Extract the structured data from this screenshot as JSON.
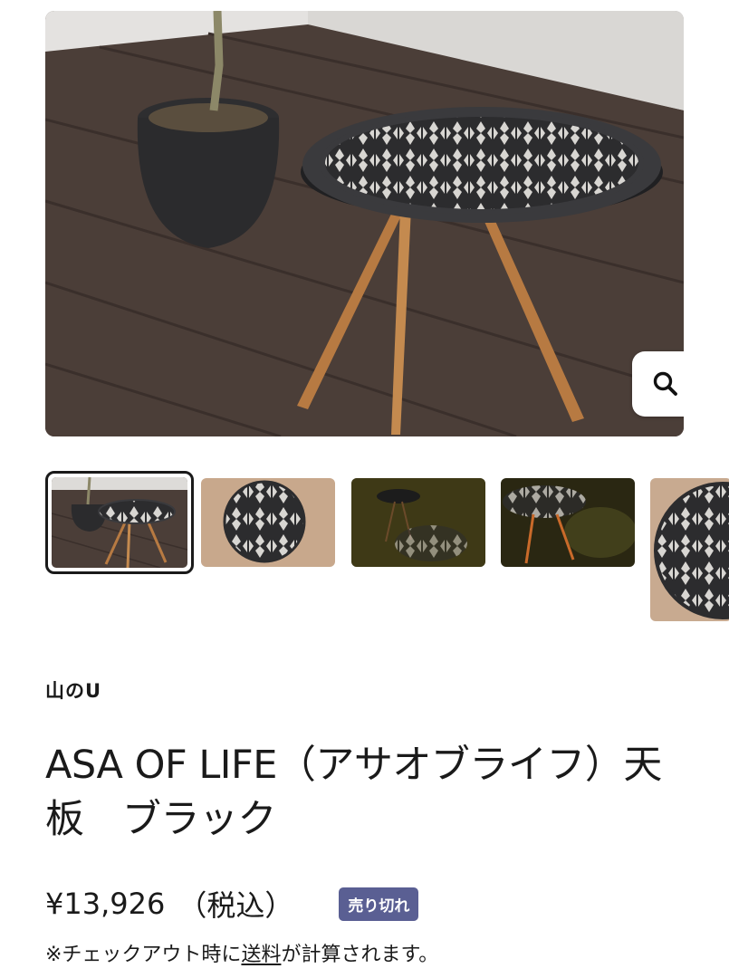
{
  "product": {
    "vendor": "山のU",
    "title": "ASA OF LIFE（アサオブライフ）天板　ブラック",
    "price": "¥13,926",
    "tax_label": "（税込）",
    "status_badge": "売り切れ",
    "shipping_note": {
      "prefix": "※チェックアウト時に",
      "link": "送料",
      "suffix": "が計算されます。"
    }
  },
  "gallery": {
    "main_image": "table-with-geometric-top-and-plant",
    "zoom_icon": "search-icon",
    "thumbnails": [
      {
        "name": "table-with-plant",
        "selected": true
      },
      {
        "name": "tabletop-flat"
      },
      {
        "name": "table-night-shadow"
      },
      {
        "name": "table-lit-night"
      },
      {
        "name": "tabletop-closeup"
      }
    ]
  },
  "colors": {
    "badge_bg": "#5a5f93",
    "text": "#1a1a1a"
  }
}
